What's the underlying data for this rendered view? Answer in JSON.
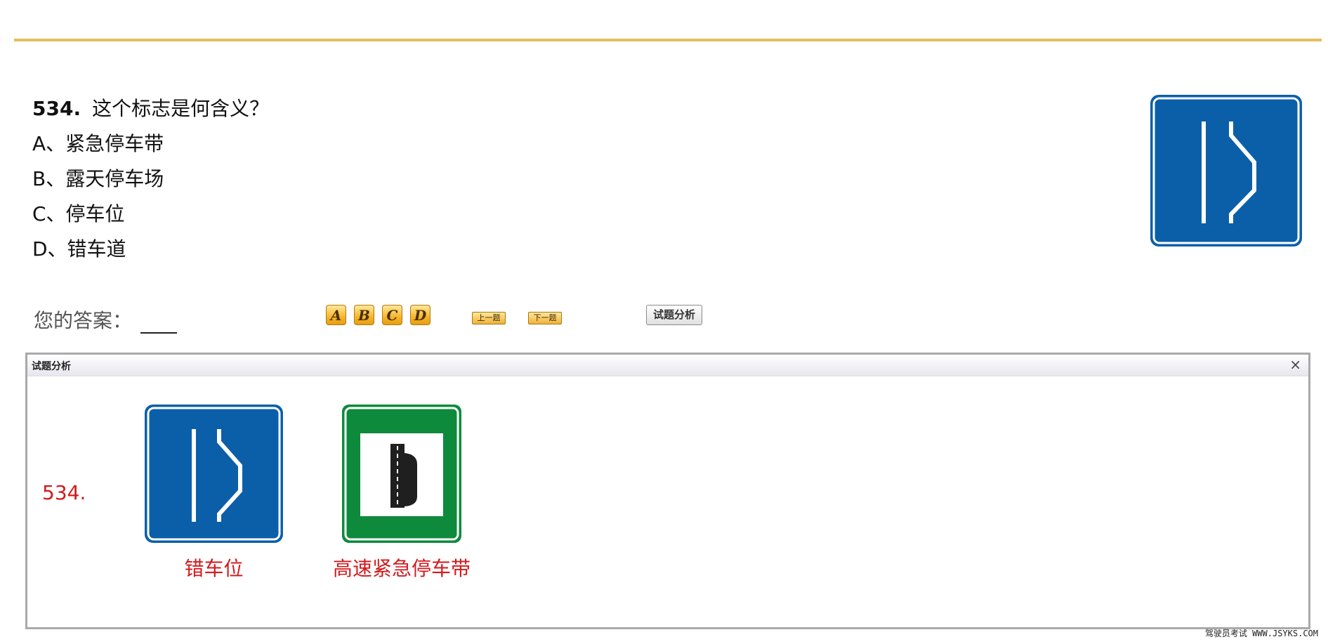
{
  "question": {
    "number": "534.",
    "text": "这个标志是何含义？",
    "options": [
      "A、紧急停车带",
      "B、露天停车场",
      "C、停车位",
      "D、错车道"
    ]
  },
  "answer": {
    "label": "您的答案：",
    "value": ""
  },
  "buttons": {
    "a": "A",
    "b": "B",
    "c": "C",
    "d": "D",
    "prev": "上一题",
    "next": "下一题",
    "analysis": "试题分析"
  },
  "analysis_dialog": {
    "title": "试题分析",
    "close": "×",
    "number": "534.",
    "captions": [
      "错车位",
      "高速紧急停车带"
    ]
  },
  "watermark": "驾驶员考试 WWW.JSYKS.COM",
  "colors": {
    "accent_line": "#e4bd5c",
    "sign_blue": "#0b5fa8",
    "sign_green": "#0d8a3c",
    "caption_red": "#d3191c"
  }
}
